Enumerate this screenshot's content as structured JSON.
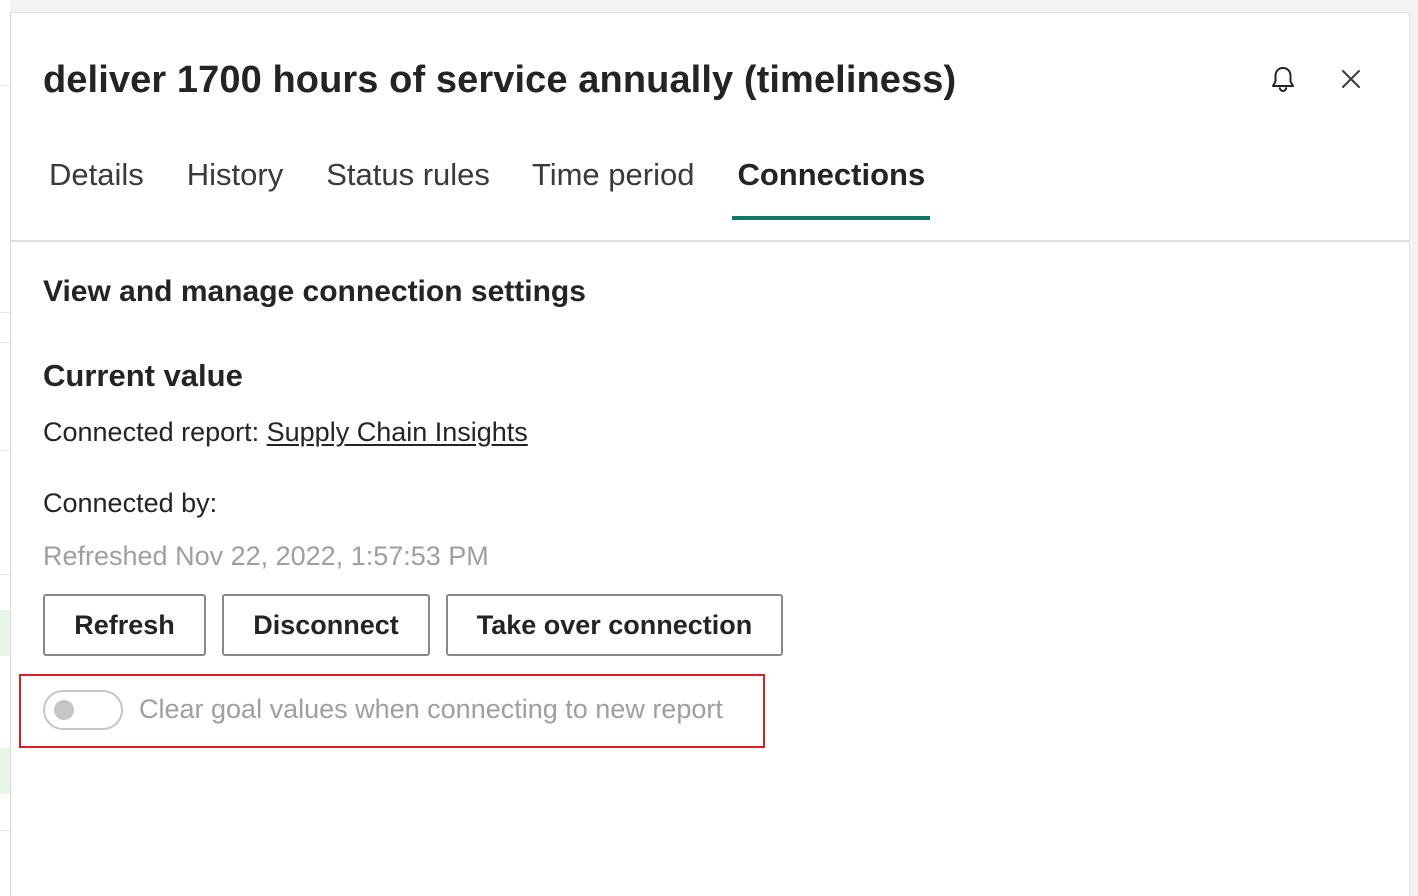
{
  "panel": {
    "title": "deliver 1700 hours of service annually (timeliness)",
    "bell_icon": "bell-icon",
    "close_icon": "close-icon"
  },
  "tabs": [
    {
      "label": "Details",
      "active": false
    },
    {
      "label": "History",
      "active": false
    },
    {
      "label": "Status rules",
      "active": false
    },
    {
      "label": "Time period",
      "active": false
    },
    {
      "label": "Connections",
      "active": true
    }
  ],
  "connections": {
    "heading": "View and manage connection settings",
    "current_value_heading": "Current value",
    "connected_report_label": "Connected report: ",
    "connected_report_name": "Supply Chain Insights",
    "connected_by_label": "Connected by:",
    "refreshed_text": "Refreshed Nov 22, 2022, 1:57:53 PM",
    "buttons": {
      "refresh": "Refresh",
      "disconnect": "Disconnect",
      "take_over": "Take over connection"
    },
    "toggle": {
      "label": "Clear goal values when connecting to new report",
      "on": false,
      "disabled": true
    }
  },
  "colors": {
    "accent": "#117865",
    "highlight_border": "#d71f26",
    "muted_text": "#a19f9d"
  }
}
